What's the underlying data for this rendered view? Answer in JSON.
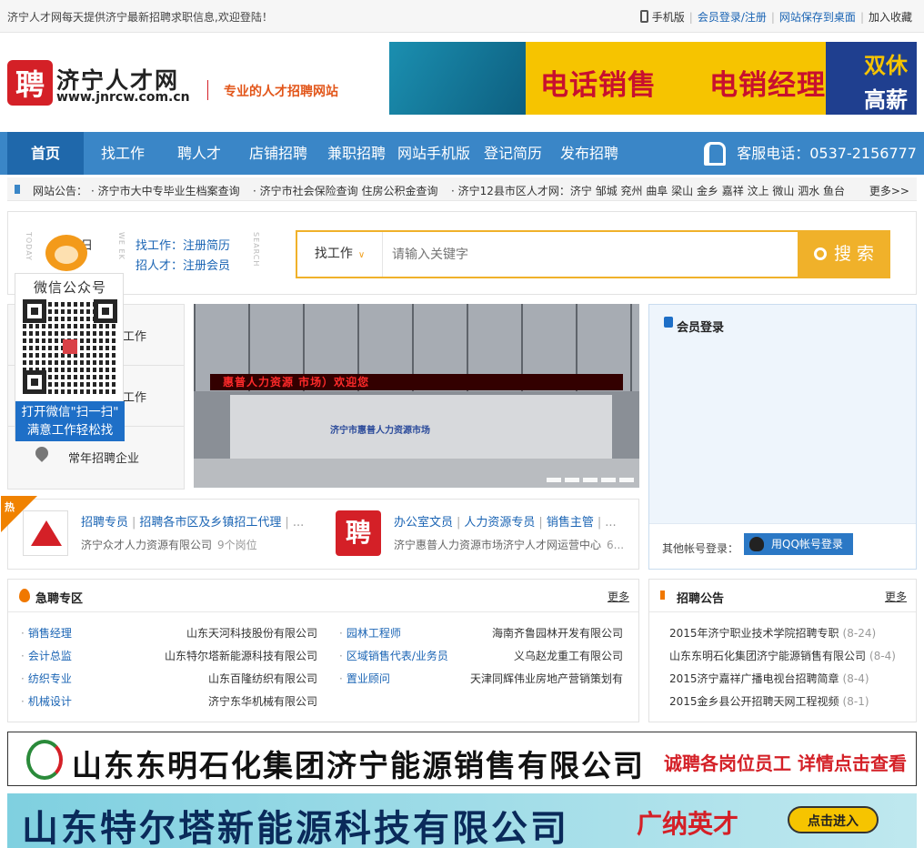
{
  "topbar": {
    "welcome": "济宁人才网每天提供济宁最新招聘求职信息,欢迎登陆！",
    "mobile": "手机版",
    "login": "会员登录/注册",
    "save_desktop": "网站保存到桌面",
    "favorite": "加入收藏"
  },
  "header": {
    "logo_char": "聘",
    "site_name": "济宁人才网",
    "site_url": "www.jnrcw.com.cn",
    "slogan": "专业的人才招聘网站",
    "banner": {
      "text1": "电话销售",
      "text2": "电销经理",
      "text3": "双休",
      "text4": "高薪"
    }
  },
  "nav": {
    "items": [
      "首页",
      "找工作",
      "聘人才",
      "店铺招聘",
      "兼职招聘",
      "网站手机版",
      "登记简历",
      "发布招聘"
    ],
    "hotline": "客服电话：0537-2156777"
  },
  "notice": {
    "label": "网站公告：",
    "items": [
      "· 济宁市大中专毕业生档案查询",
      "· 济宁市社会保险查询 住房公积金查询",
      "· 济宁12县市区人才网：济宁 邹城 兖州 曲阜 梁山 金乡 嘉祥 汶上 微山 泗水 鱼台"
    ],
    "more": "更多>>"
  },
  "search": {
    "date_label": "日",
    "link_find": "找工作：注册简历",
    "link_hire": "招人才：注册会员",
    "category": "找工作",
    "placeholder": "请输入关键字",
    "button": "搜 索"
  },
  "wechat": {
    "title": "微信公众号",
    "line1": "打开微信\"扫一扫\"",
    "line2": "满意工作轻松找"
  },
  "catmenu": {
    "row1": "工作",
    "row2": "工作",
    "row3": "常年招聘企业"
  },
  "slide": {
    "led_text": "惠普人力资源 市场）欢迎您",
    "desk_name": "济宁市惠普人力资源市场"
  },
  "login": {
    "title": "会员登录",
    "other_label": "其他帐号登录：",
    "qq_button": "用QQ帐号登录"
  },
  "hot": {
    "tag": "热",
    "company1": {
      "jobs": [
        "招聘专员",
        "招聘各市区及乡镇招工代理",
        "..."
      ],
      "name": "济宁众才人力资源有限公司",
      "count": "9个岗位"
    },
    "company2": {
      "logo_char": "聘",
      "jobs": [
        "办公室文员",
        "人力资源专员",
        "销售主管",
        "..."
      ],
      "name": "济宁惠普人力资源市场济宁人才网运营中心",
      "count": "6..."
    }
  },
  "urgent": {
    "title": "急聘专区",
    "more": "更多",
    "left": [
      {
        "job": "销售经理",
        "company": "山东天河科技股份有限公司"
      },
      {
        "job": "会计总监",
        "company": "山东特尔塔新能源科技有限公司"
      },
      {
        "job": "纺织专业",
        "company": "山东百隆纺织有限公司"
      },
      {
        "job": "机械设计",
        "company": "济宁东华机械有限公司"
      }
    ],
    "right": [
      {
        "job": "园林工程师",
        "company": "海南齐鲁园林开发有限公司"
      },
      {
        "job": "区域销售代表/业务员",
        "company": "义乌赵龙重工有限公司"
      },
      {
        "job": "置业顾问",
        "company": "天津同辉伟业房地产营销策划有"
      }
    ]
  },
  "announcements": {
    "title": "招聘公告",
    "more": "更多",
    "items": [
      {
        "text": "2015年济宁职业技术学院招聘专职",
        "date": "(8-24)"
      },
      {
        "text": "山东东明石化集团济宁能源销售有限公司",
        "date": "(8-4)"
      },
      {
        "text": "2015济宁嘉祥广播电视台招聘简章",
        "date": "(8-4)"
      },
      {
        "text": "2015金乡县公开招聘天网工程视频",
        "date": "(8-1)"
      }
    ]
  },
  "ads": {
    "ad1_name": "山东东明石化集团济宁能源销售有限公司",
    "ad1_cta": "诚聘各岗位员工 详情点击查看",
    "ad2_name": "山东特尔塔新能源科技有限公司",
    "ad2_cta": "广纳英才",
    "ad2_button": "点击进入"
  },
  "colors": {
    "nav": "#3a86c7",
    "nav_active": "#1f68ab",
    "accent": "#f0b12a",
    "brand_red": "#d42027",
    "link": "#1a64b4"
  }
}
